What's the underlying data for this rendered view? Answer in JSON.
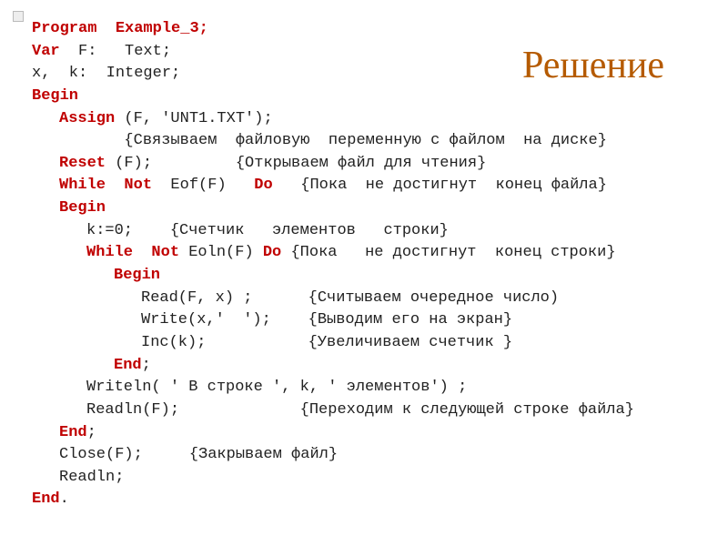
{
  "slide": {
    "title": "Решение"
  },
  "code": {
    "l01_kw1": "Program",
    "l01_name": "  Example_3;",
    "l02_kw1": "Var",
    "l02_txt": "  F:   Text;",
    "l03_txt": "x,  k:  Integer;",
    "l04_kw": "Begin",
    "l05_kw": "Assign",
    "l05_txt": " (F, 'UNT1.TXT');",
    "l06_txt": "       {Связываем  файловую  переменную с файлом  на диске}",
    "l07_kw": "Reset",
    "l07_txt": " (F);         {Открываем файл для чтения}",
    "l08_kw1": "While",
    "l08_txt1": "  ",
    "l08_kw2": "Not",
    "l08_txt2": "  Eof(F)   ",
    "l08_kw3": "Do",
    "l08_txt3": "   {Пока  не достигнут  конец файла}",
    "l09_kw": "Begin",
    "l10_txt": "k:=0;    {Счетчик   элементов   строки}",
    "l11_kw1": "While",
    "l11_txt1": "  ",
    "l11_kw2": "Not",
    "l11_txt2": " Eoln(F) ",
    "l11_kw3": "Do",
    "l11_txt3": " {Пока   не достигнут  конец строки}",
    "l12_kw": "Begin",
    "l13_txt": "Read(F, x) ;      {Считываем очередное число)",
    "l14_txt": "Write(x,'  ');    {Выводим его на экран}",
    "l15_txt": "Inc(k);           {Увеличиваем счетчик }",
    "l16_kw": "End",
    "l16_txt": ";",
    "l17_txt": "Writeln( ' В строке ', k, ' элементов') ;",
    "l18_txt": "Readln(F);             {Переходим к следующей строке файла}",
    "l19_kw": "End",
    "l19_txt": ";",
    "l20_txt": "Close(F);     {Закрываем файл}",
    "l21_txt": "Readln;",
    "l22_kw": "End",
    "l22_txt": "."
  }
}
